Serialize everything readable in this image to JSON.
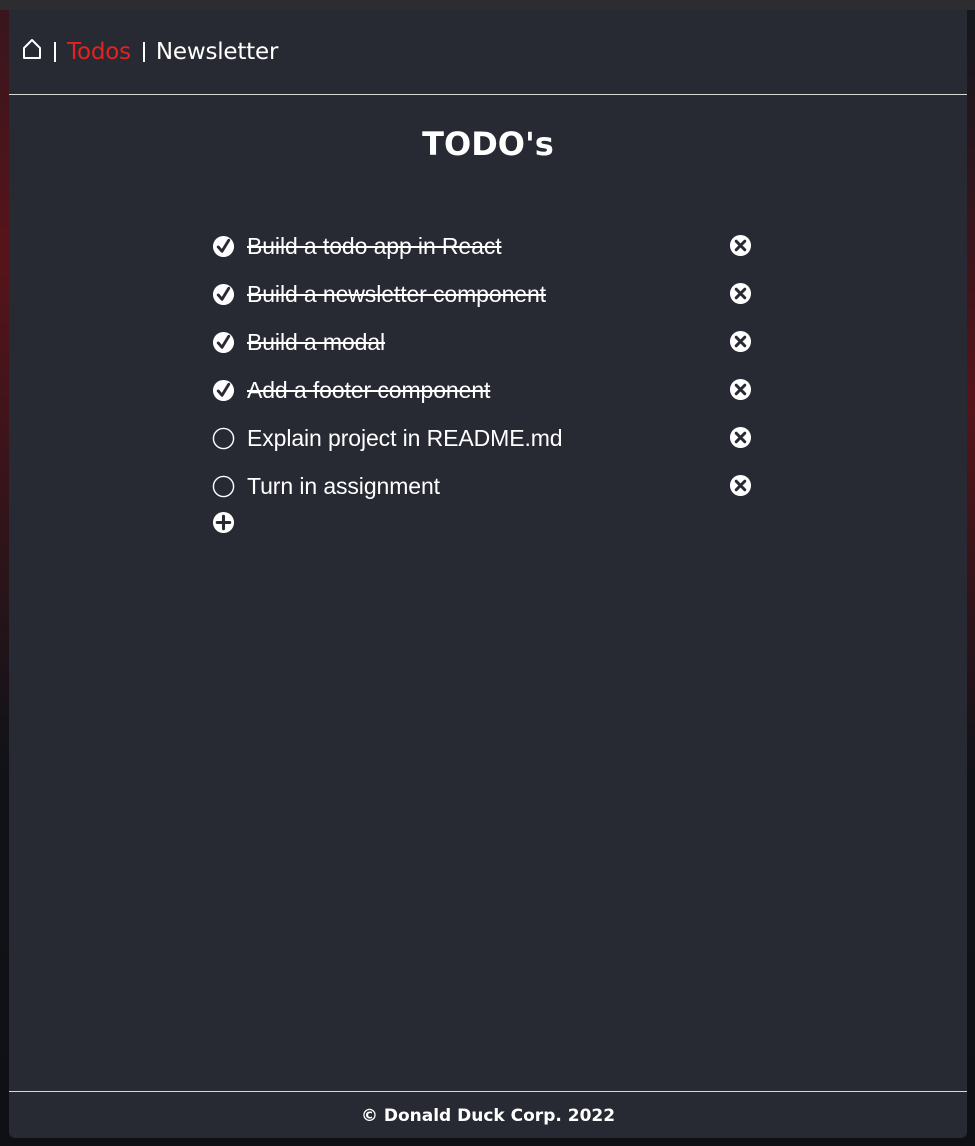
{
  "nav": {
    "home_icon": "home-icon",
    "links": [
      {
        "label": "Todos",
        "active": true
      },
      {
        "label": "Newsletter",
        "active": false
      }
    ],
    "active_color": "#e32222"
  },
  "page": {
    "title": "TODO's"
  },
  "todos": [
    {
      "text": "Build a todo app in React",
      "done": true
    },
    {
      "text": "Build a newsletter component",
      "done": true
    },
    {
      "text": "Build a modal",
      "done": true
    },
    {
      "text": "Add a footer component",
      "done": true
    },
    {
      "text": "Explain project in README.md",
      "done": false
    },
    {
      "text": "Turn in assignment",
      "done": false
    }
  ],
  "icons": {
    "done": "check-circle-icon",
    "pending": "empty-circle-icon",
    "delete": "x-circle-icon",
    "add": "plus-circle-icon"
  },
  "footer": {
    "text": "© Donald Duck Corp. 2022"
  },
  "colors": {
    "background": "#272a33",
    "text": "#ffffff",
    "accent": "#e32222"
  }
}
